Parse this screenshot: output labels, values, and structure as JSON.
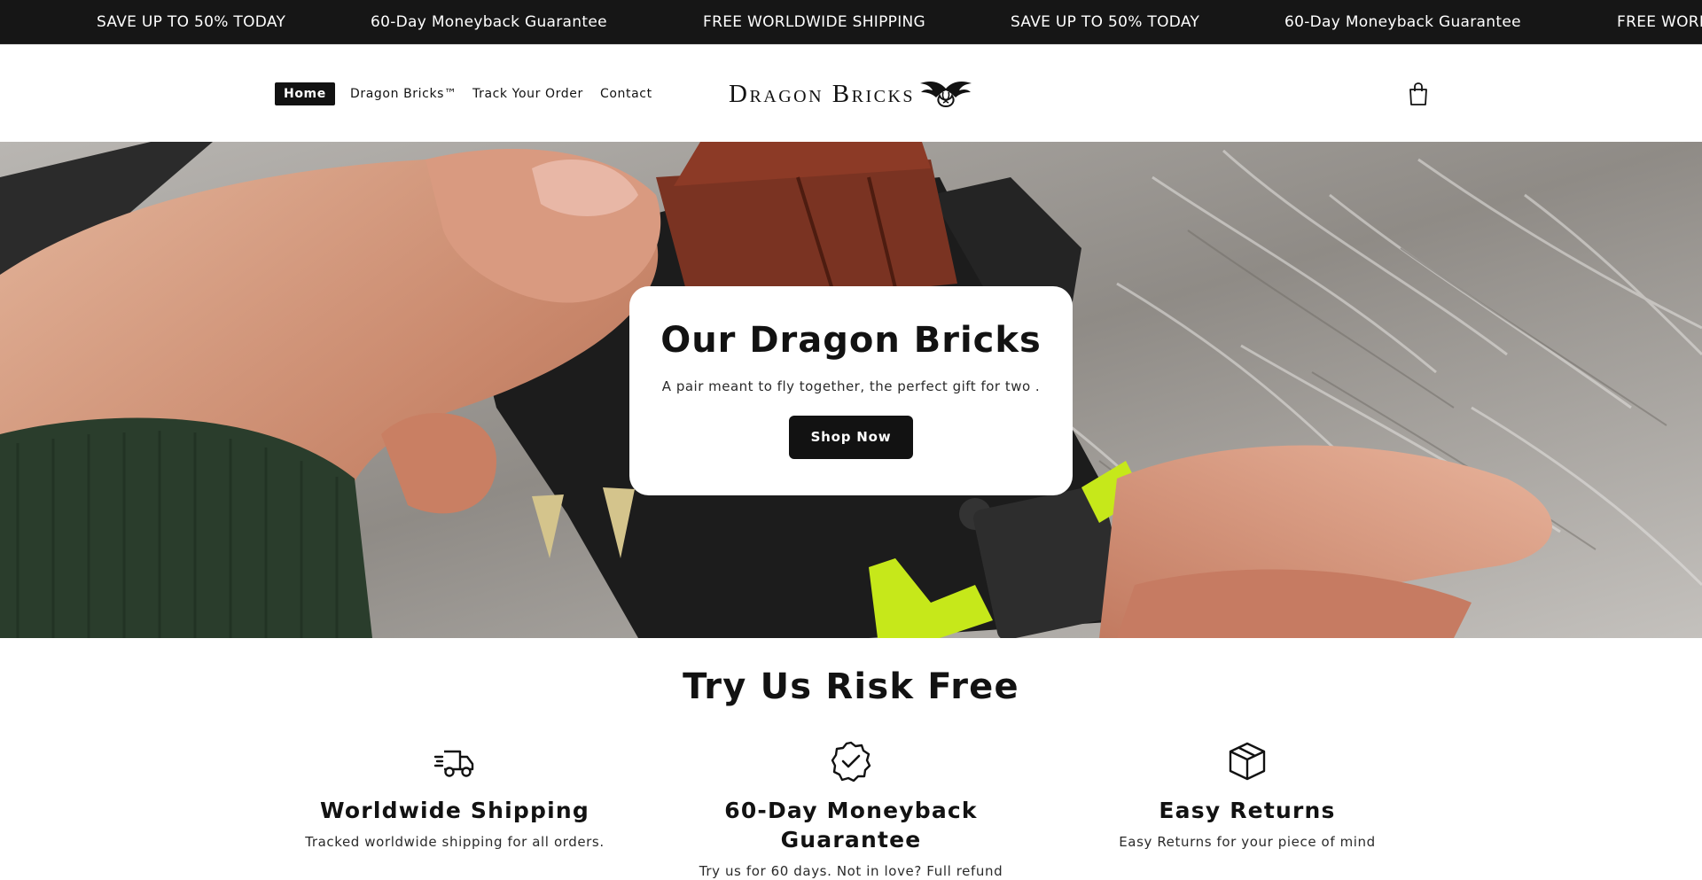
{
  "announcement": {
    "items": [
      "SAVE UP TO 50% TODAY",
      "60-Day Moneyback Guarantee",
      "FREE WORLDWIDE SHIPPING",
      "SAVE UP TO 50% TODAY",
      "60-Day Moneyback Guarantee",
      "FREE WORLDWIDE SHIPPING"
    ],
    "background": "#161616",
    "text_color": "#ffffff"
  },
  "header": {
    "nav": [
      {
        "label": "Home",
        "active": true
      },
      {
        "label": "Dragon Bricks™",
        "active": false
      },
      {
        "label": "Track Your Order",
        "active": false
      },
      {
        "label": "Contact",
        "active": false
      }
    ],
    "logo_text": "Dragon Bricks",
    "cart_icon": "shopping-bag-icon"
  },
  "hero": {
    "title": "Our Dragon Bricks",
    "subtitle": "A pair meant to fly together, the perfect gift for two   .",
    "button_label": "Shop Now"
  },
  "features": {
    "title": "Try Us Risk Free",
    "items": [
      {
        "icon": "delivery-truck-icon",
        "title": "Worldwide Shipping",
        "text": "Tracked worldwide shipping for all orders."
      },
      {
        "icon": "check-badge-icon",
        "title": "60-Day Moneyback Guarantee",
        "text": "Try us for 60 days. Not in love? Full refund"
      },
      {
        "icon": "package-box-icon",
        "title": "Easy Returns",
        "text": "Easy Returns for your piece of mind"
      }
    ]
  },
  "colors": {
    "primary": "#121212",
    "background": "#ffffff",
    "accent_lime": "#c6e81a"
  }
}
